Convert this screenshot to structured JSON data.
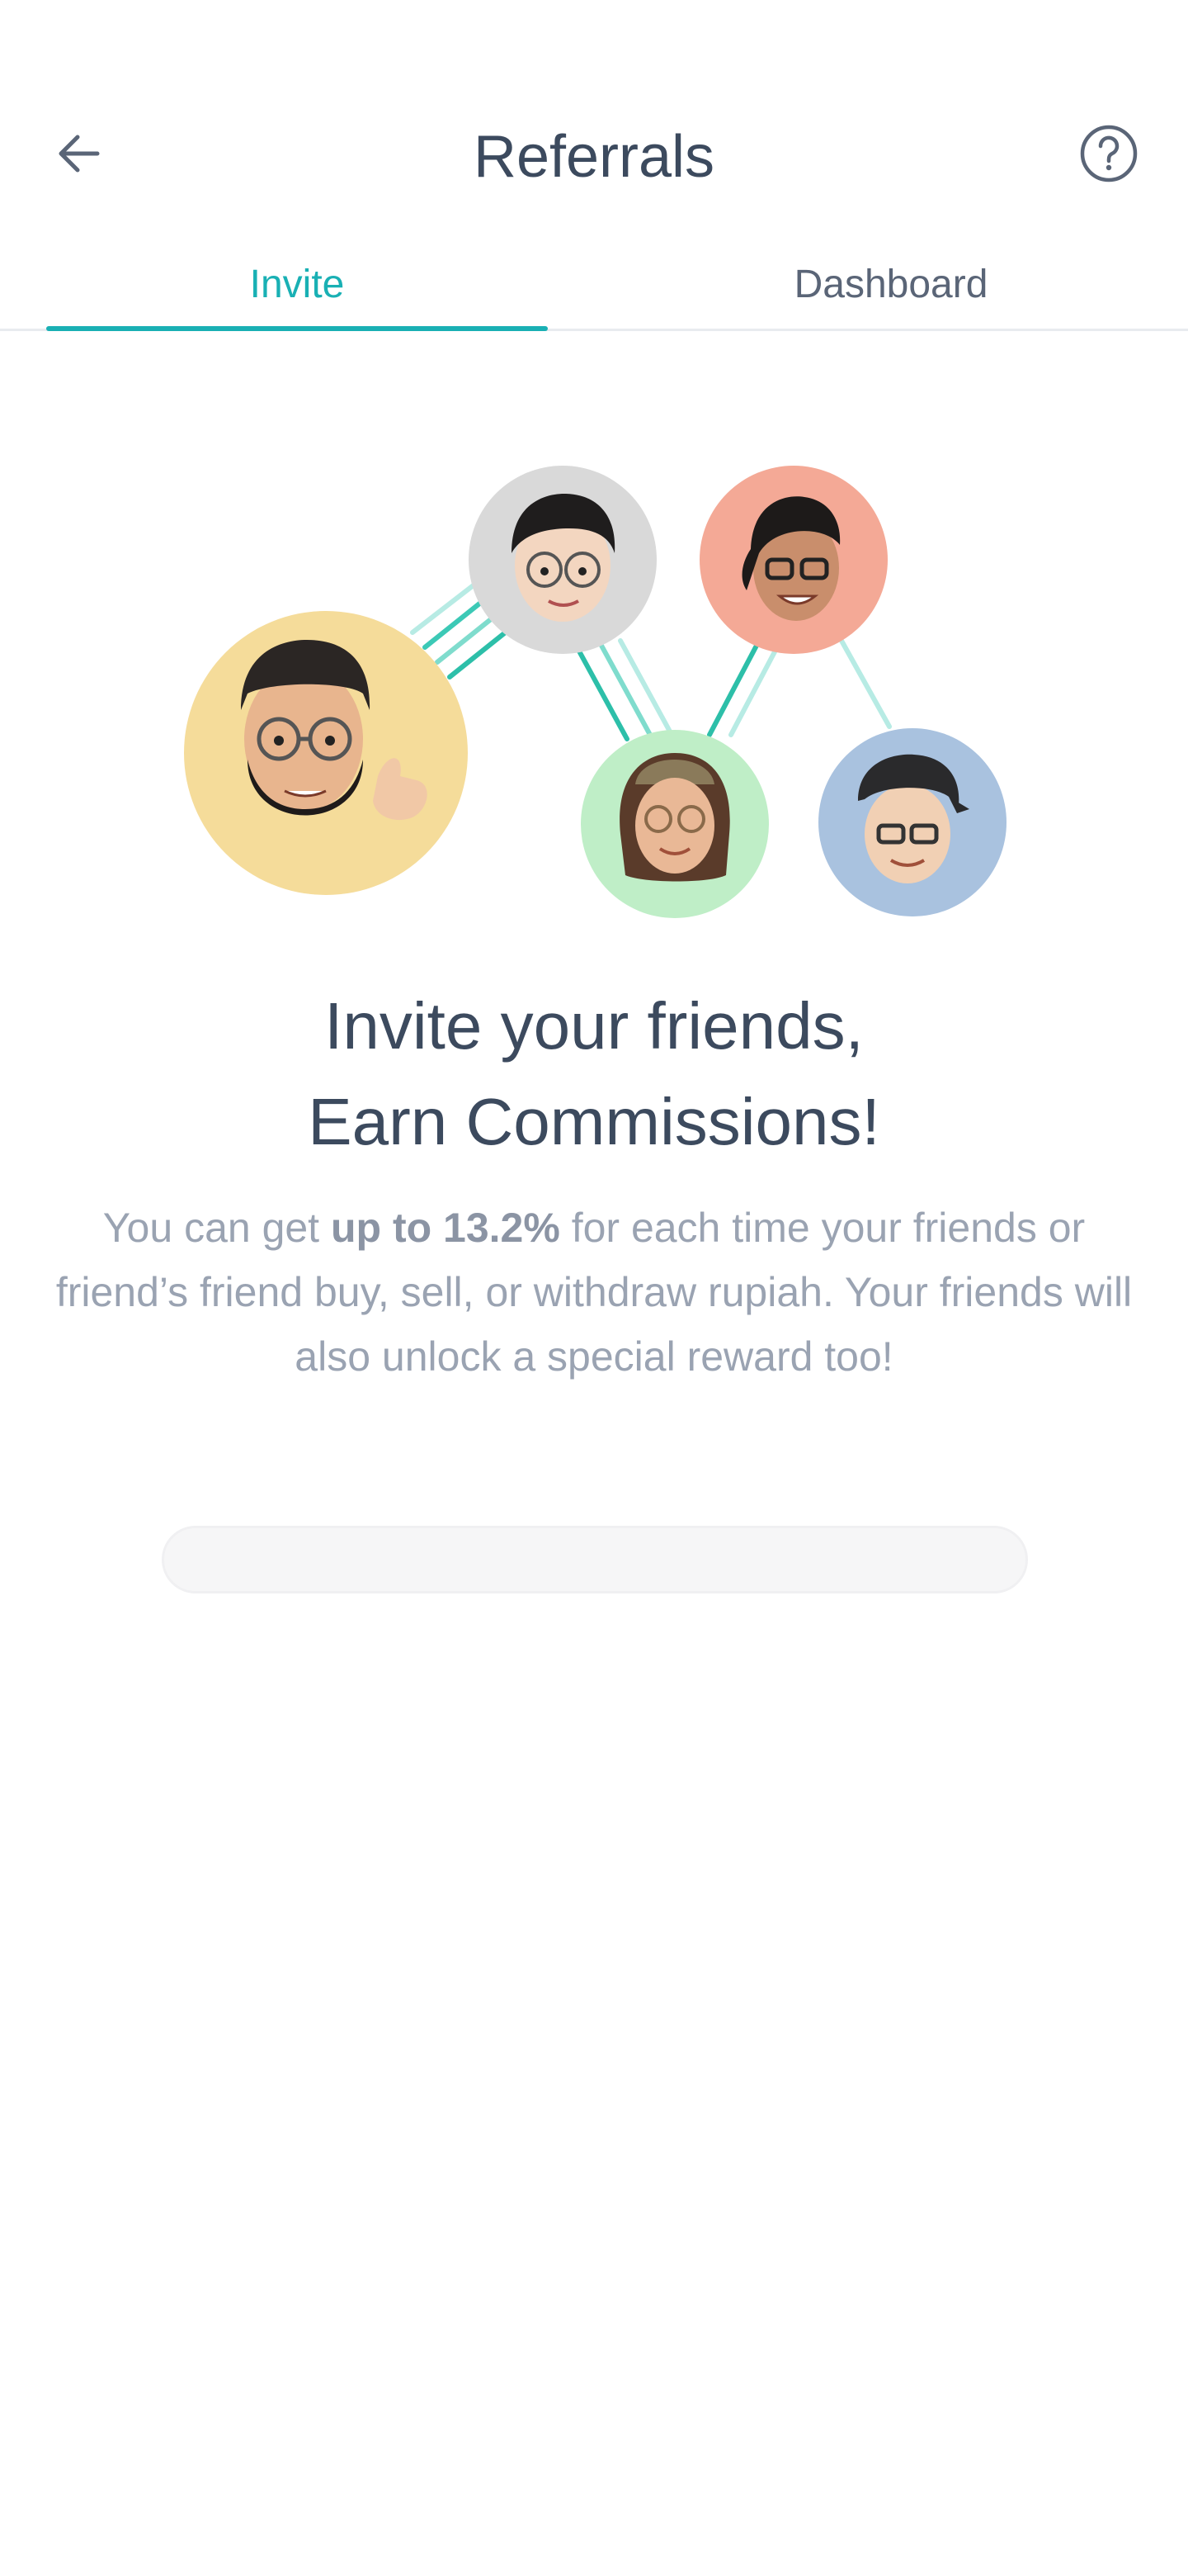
{
  "header": {
    "title": "Referrals",
    "back_icon": "arrow-left-icon",
    "help_icon": "question-circle-icon"
  },
  "tabs": [
    {
      "label": "Invite",
      "active": true
    },
    {
      "label": "Dashboard",
      "active": false
    }
  ],
  "colors": {
    "accent": "#19b0b4",
    "text_primary": "#3c4a5e",
    "text_secondary": "#9aa3b2",
    "avatar_bg_yellow": "#f5dc9a",
    "avatar_bg_gray": "#d9d9d9",
    "avatar_bg_salmon": "#f4a996",
    "avatar_bg_green": "#bfeec7",
    "avatar_bg_blue": "#a9c2df"
  },
  "hero": {
    "headline_line1": "Invite your friends,",
    "headline_line2": "Earn Commissions!",
    "description_pre": "You can get ",
    "description_bold": "up to 13.2%",
    "description_post": " for each time your friends or friend’s friend buy, sell, or withdraw rupiah. Your friends will also unlock a special reward too!"
  },
  "avatars": [
    {
      "name": "avatar-main-user",
      "bg": "#f5dc9a"
    },
    {
      "name": "avatar-friend-1",
      "bg": "#d9d9d9"
    },
    {
      "name": "avatar-friend-2",
      "bg": "#f4a996"
    },
    {
      "name": "avatar-friend-3",
      "bg": "#bfeec7"
    },
    {
      "name": "avatar-friend-4",
      "bg": "#a9c2df"
    }
  ]
}
